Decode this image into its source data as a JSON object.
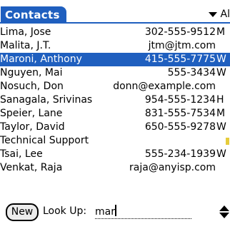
{
  "header": {
    "title": "Contacts",
    "category": "Al"
  },
  "colors": {
    "accent": "#1f5fbf",
    "memo_mark": "#e6cc3b"
  },
  "contacts": [
    {
      "name": "Lima, Jose",
      "info": "302-555-9512",
      "type": "M"
    },
    {
      "name": "Malita, J.T.",
      "info": "jtm@jtm.com",
      "type": ""
    },
    {
      "name": "Maroni, Anthony",
      "info": "415-555-7775",
      "type": "W",
      "selected": true
    },
    {
      "name": "Nguyen, Mai",
      "info": "555-3434",
      "type": "W"
    },
    {
      "name": "Nosuch, Don",
      "info": "donn@example.com",
      "type": ""
    },
    {
      "name": "Sanagala, Srivinas",
      "info": "954-555-1234",
      "type": "H"
    },
    {
      "name": "Speier, Lane",
      "info": "831-555-7534",
      "type": "M"
    },
    {
      "name": "Taylor, David",
      "info": "650-555-9278",
      "type": "W"
    },
    {
      "name": "Technical Support",
      "info": "",
      "type": ""
    },
    {
      "name": "Tsai, Lee",
      "info": "555-234-1939",
      "type": "W"
    },
    {
      "name": "Venkat, Raja",
      "info": "raja@anyisp.com",
      "type": ""
    }
  ],
  "footer": {
    "new_label": "New",
    "lookup_label": "Look Up:",
    "lookup_value": "mar"
  },
  "icons": {
    "category": "dropdown-triangle-icon",
    "scroll": "scroll-arrows-icon"
  }
}
